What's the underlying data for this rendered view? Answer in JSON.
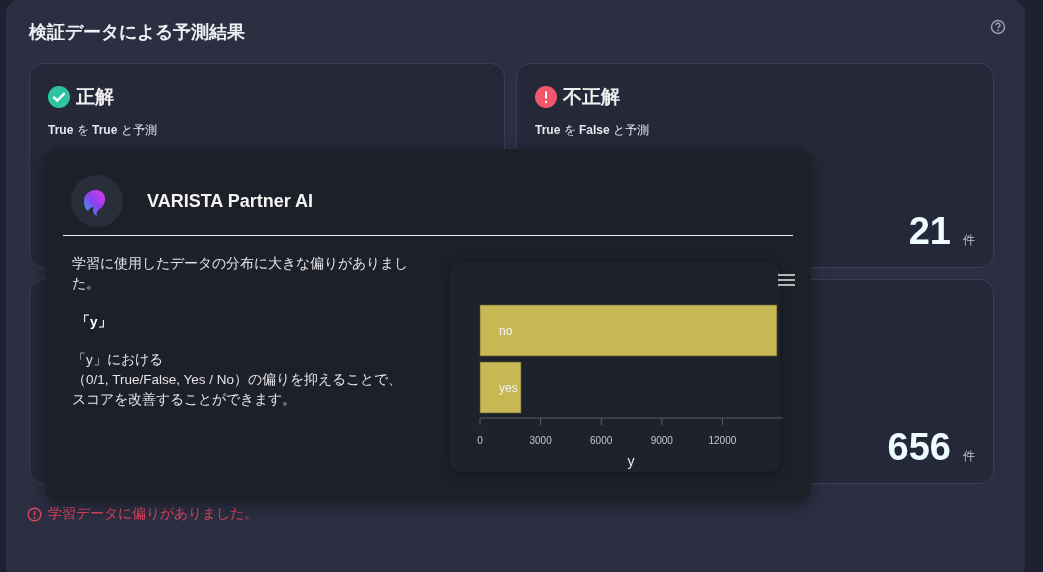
{
  "title": "検証データによる予測結果",
  "cards": [
    {
      "kind": "correct",
      "heading": "正解",
      "subtitle": "**True** を **True** と予測"
    },
    {
      "kind": "incorrect",
      "heading": "不正解",
      "subtitle": "**True** を **False** と予測",
      "count": "21",
      "unit": "件"
    },
    {
      "count": "656",
      "unit": "件"
    }
  ],
  "assistant": {
    "name": "VARISTA Partner AI",
    "message": "学習に使用したデータの分布に大きな偏りがありました。",
    "column": "「y」",
    "advice": [
      "「y」における",
      "（0/1, True/False, Yes / No）の偏りを抑えることで、",
      "スコアを改善することができます。"
    ],
    "chart_data": {
      "type": "bar",
      "orientation": "horizontal",
      "xlabel": "y",
      "categories": [
        "no",
        "yes"
      ],
      "series": [
        {
          "color": "#c7b854",
          "values": [
            14700,
            2030
          ]
        }
      ],
      "xlim": [
        0,
        15000
      ],
      "xticks": [
        0,
        3000,
        6000,
        9000,
        12000
      ]
    }
  },
  "error": "学習データに偏りがありました。"
}
